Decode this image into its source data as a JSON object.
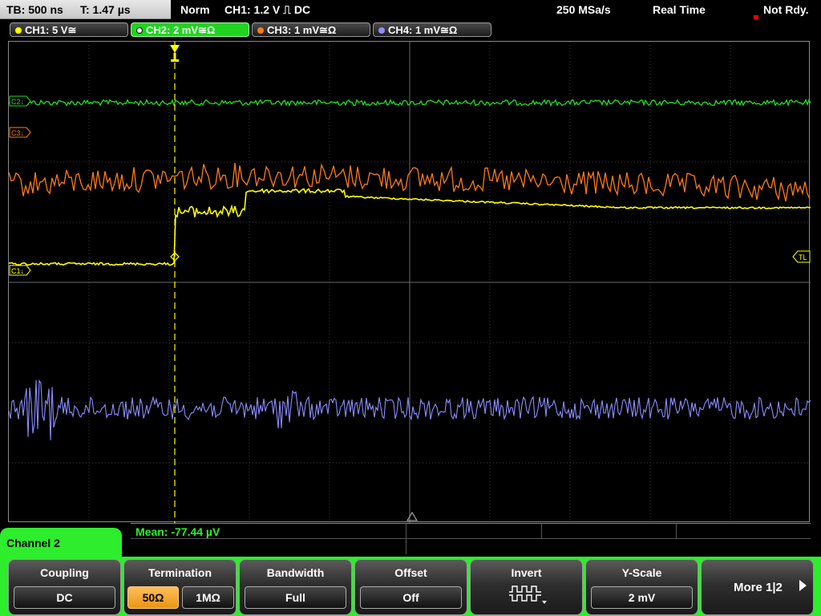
{
  "topbar": {
    "timebase": "TB: 500 ns",
    "trigger_time": "T: 1.47 µs",
    "mode": "Norm",
    "trigger_info": "CH1: 1.2 V ⎍ DC",
    "sample_rate": "250 MSa/s",
    "acq_mode": "Real Time",
    "status": "Not Rdy."
  },
  "channels": [
    {
      "label": "CH1: 5 V≅",
      "color": "#ffff00"
    },
    {
      "label": "CH2: 2 mV≅Ω",
      "color": "#22dd22"
    },
    {
      "label": "CH3: 1 mV≅Ω",
      "color": "#ff7a1a"
    },
    {
      "label": "CH4: 1 mV≅Ω",
      "color": "#8c8cff"
    }
  ],
  "markers": {
    "c2": "C2↓",
    "c3": "C3↓",
    "c1": "C1↓",
    "tl": "TL"
  },
  "measurement": {
    "label": "Mean: -77.44 µV"
  },
  "panel": {
    "channel_name": "Channel 2",
    "coupling": {
      "title": "Coupling",
      "value": "DC"
    },
    "termination": {
      "title": "Termination",
      "opt1": "50Ω",
      "opt2": "1MΩ"
    },
    "bandwidth": {
      "title": "Bandwidth",
      "value": "Full"
    },
    "offset": {
      "title": "Offset",
      "value": "Off"
    },
    "invert": {
      "title": "Invert"
    },
    "yscale": {
      "title": "Y-Scale",
      "value": "2 mV"
    },
    "more": {
      "label": "More 1|2"
    }
  }
}
